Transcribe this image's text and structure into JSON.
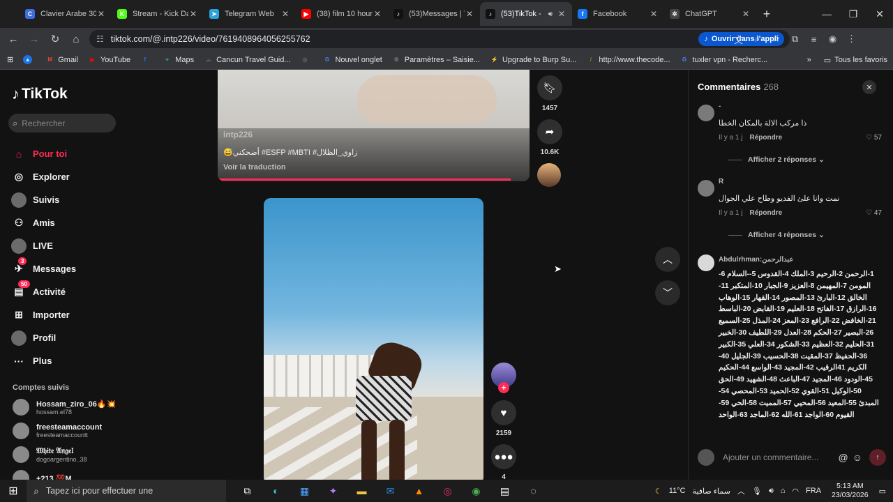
{
  "browser": {
    "tabs": [
      {
        "title": "Clavier Arabe 30",
        "color": "#3c6ee0",
        "glyph": "C",
        "active": false
      },
      {
        "title": "Stream - Kick Da",
        "color": "#53fc18",
        "glyph": "K",
        "active": false
      },
      {
        "title": "Telegram Web",
        "color": "#2aa3df",
        "glyph": "➤",
        "active": false
      },
      {
        "title": "(38) film 10 hour",
        "color": "#ff0000",
        "glyph": "▶",
        "active": false
      },
      {
        "title": "(53)Messages | T",
        "color": "#111111",
        "glyph": "♪",
        "active": false
      },
      {
        "title": "(53)TikTok - ",
        "color": "#111111",
        "glyph": "♪",
        "active": true
      },
      {
        "title": "Facebook",
        "color": "#1877f2",
        "glyph": "f",
        "active": false
      },
      {
        "title": "ChatGPT",
        "color": "#444444",
        "glyph": "✲",
        "active": false
      }
    ],
    "url": "tiktok.com/@.intp226/video/7619408964056255762",
    "open_app_label": "Ouvrir dans l'appli",
    "bookmarks": [
      {
        "label": "Gmail",
        "color": "#ea4335",
        "glyph": "M"
      },
      {
        "label": "YouTube",
        "color": "#ff0000",
        "glyph": "▶"
      },
      {
        "label": "",
        "color": "#1877f2",
        "glyph": "f"
      },
      {
        "label": "Maps",
        "color": "#34a853",
        "glyph": "⌖"
      },
      {
        "label": "Cancun Travel Guid...",
        "color": "#555555",
        "glyph": "☁"
      },
      {
        "label": "",
        "color": "#666666",
        "glyph": "◎"
      },
      {
        "label": "Nouvel onglet",
        "color": "#4285f4",
        "glyph": "G"
      },
      {
        "label": "Paramètres – Saisie...",
        "color": "#777777",
        "glyph": "⚙"
      },
      {
        "label": "Upgrade to Burp Su...",
        "color": "#ff6633",
        "glyph": "⚡"
      },
      {
        "label": "http://www.thecode...",
        "color": "#6b8e23",
        "glyph": "/"
      },
      {
        "label": "tuxler vpn - Recherc...",
        "color": "#4285f4",
        "glyph": "G"
      }
    ],
    "all_bookmarks_label": "Tous les favoris"
  },
  "sidebar": {
    "logo": "TikTok",
    "search_placeholder": "Rechercher",
    "nav": [
      {
        "label": "Pour toi",
        "icon": "⌂",
        "active": true,
        "badge": ""
      },
      {
        "label": "Explorer",
        "icon": "◎",
        "active": false,
        "badge": ""
      },
      {
        "label": "Suivis",
        "icon": "",
        "active": false,
        "badge": ""
      },
      {
        "label": "Amis",
        "icon": "⚇",
        "active": false,
        "badge": ""
      },
      {
        "label": "LIVE",
        "icon": "",
        "active": false,
        "badge": ""
      },
      {
        "label": "Messages",
        "icon": "✈",
        "active": false,
        "badge": "3"
      },
      {
        "label": "Activité",
        "icon": "▤",
        "active": false,
        "badge": "50"
      },
      {
        "label": "Importer",
        "icon": "⊞",
        "active": false,
        "badge": ""
      },
      {
        "label": "Profil",
        "icon": "",
        "active": false,
        "badge": ""
      },
      {
        "label": "Plus",
        "icon": "···",
        "active": false,
        "badge": ""
      }
    ],
    "following_heading": "Comptes suivis",
    "following": [
      {
        "name": "Hossam_ziro_06🔥💥",
        "handle": "hossam.el78"
      },
      {
        "name": "freesteamaccount",
        "handle": "freesteamaccountt"
      },
      {
        "name": "𝔚𝔥𝔦𝔱𝔢 𝔄𝔫𝔤𝔢𝔩",
        "handle": "dogoargentino..38"
      },
      {
        "name": "+213 💯M",
        "handle": ""
      }
    ]
  },
  "feed": {
    "video1": {
      "username": "intp226",
      "caption": "😅أضحكني #ESFP #MBTI #زاوي_الظلال",
      "translate_label": "Voir la traduction",
      "progress": 0.94,
      "saves": "1457",
      "shares": "10.6K"
    },
    "video2": {
      "likes": "2159",
      "comments": "4"
    }
  },
  "comments": {
    "title": "Commentaires",
    "count": "268",
    "items": [
      {
        "user": "-",
        "text": "ذا مركب الالة بالمكان الخطا",
        "time": "Il y a 1 j",
        "reply_label": "Répondre",
        "likes": "57",
        "view_replies": "Afficher 2 réponses"
      },
      {
        "user": "R",
        "text": "نمت وانا علئ الفديو وطاح علي الجوال",
        "time": "Il y a 1 j",
        "reply_label": "Répondre",
        "likes": "47",
        "view_replies": "Afficher 4 réponses"
      },
      {
        "user": "Abdulrhman:عبدالرحمن",
        "text": "1-الرحمن 2-الرحيم 3-الملك 4-القدوس 5--السلام 6-المومن 7-المهيمن 8-العزيز 9-الجبار 10-المتكبر 11-الخالق 12-البارئ 13-المصور 14-القهار 15-الوهاب 16-الرازق 17-الفاتح 18-العليم 19-القابض 20-الباسط 21-الخافض 22-الرافع 23-المعز 24-المذل 25-السميع 26-البصير 27-الحكم 28-العدل 29-اللطيف 30-الخبير 31-الحليم 32-العظيم 33-الشكور 34-العلي 35-الكبير 36-الحفيظ 37-المقيت 38-الحسيب 39-الجليل 40-الكريم 41الرقيب 42-المجيد 43-الواسع 44-الحكيم 45-الودود 46-المجيد 47-الباعث 48-الشهيد 49-الحق 50-الوكيل 51-القوي 52-الحميد 53-المحصي 54-المبدئ 55-المعيد 56-المحيي 57-المميت 58-الحي 59-القيوم 60-الواجد 61-الله 62-الماجد 63-الواحد"
      }
    ],
    "input_placeholder": "Ajouter un commentaire..."
  },
  "taskbar": {
    "search_placeholder": "Tapez ici pour effectuer une",
    "temperature": "11°C",
    "weather": "سماء صافية",
    "language": "FRA",
    "time": "5:13 AM",
    "date": "23/03/2026"
  }
}
